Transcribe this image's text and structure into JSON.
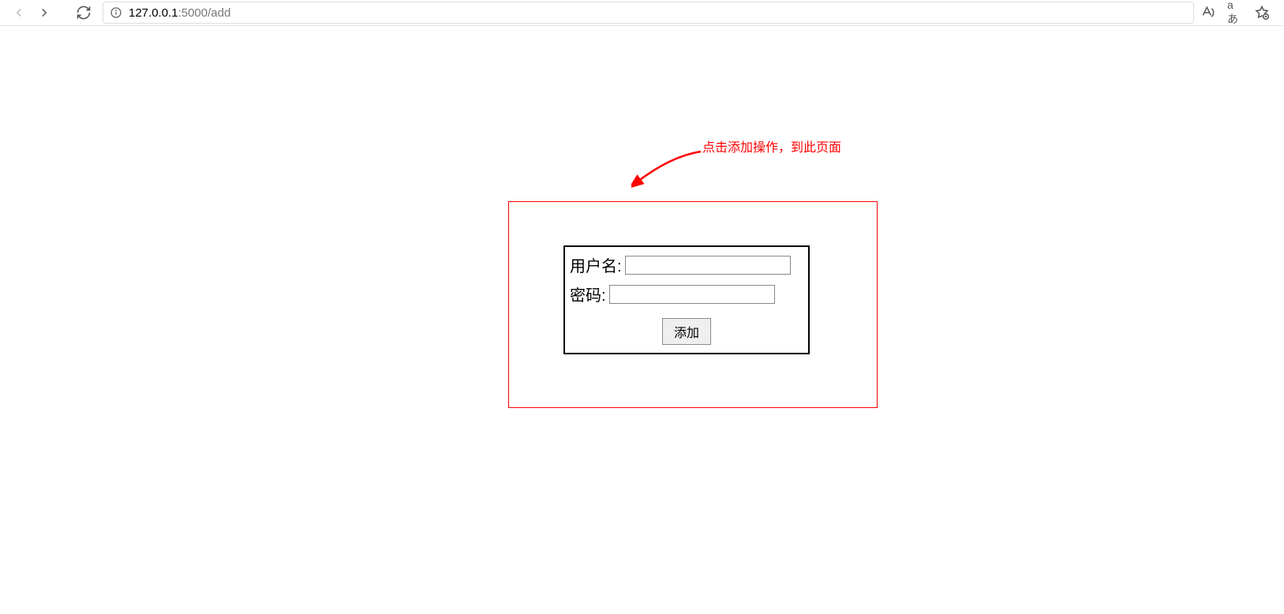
{
  "browser": {
    "url_host": "127.0.0.1",
    "url_rest": ":5000/add"
  },
  "annotation": {
    "text": "点击添加操作，到此页面"
  },
  "form": {
    "username_label": "用户名:",
    "password_label": "密码:",
    "submit_label": "添加",
    "username_value": "",
    "password_value": ""
  }
}
